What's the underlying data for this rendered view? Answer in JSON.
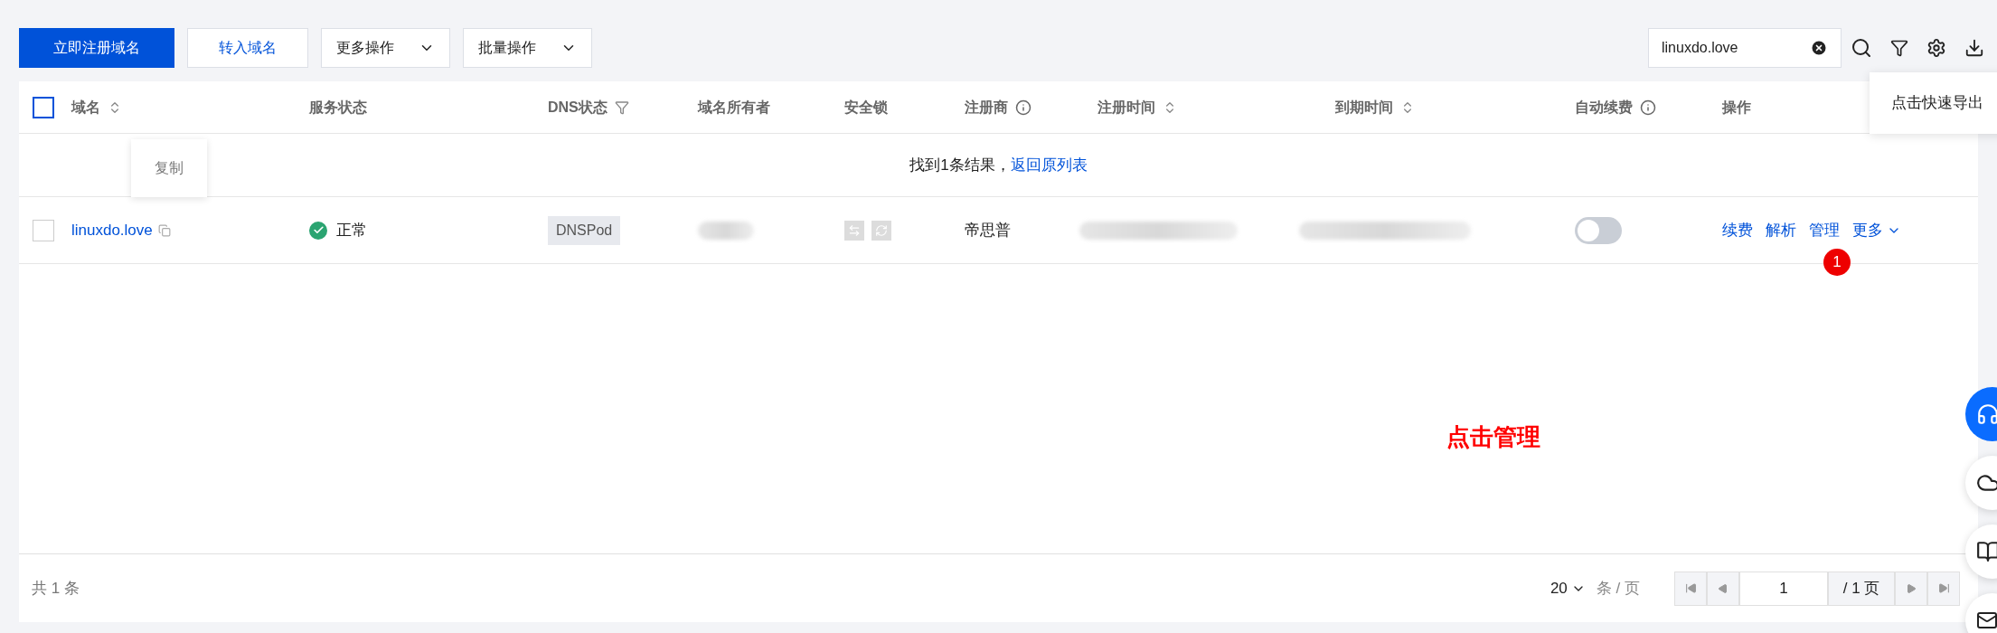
{
  "toolbar": {
    "buttons": [
      {
        "label": "立即注册域名",
        "kind": "primary"
      },
      {
        "label": "转入域名",
        "kind": "link"
      },
      {
        "label": "更多操作",
        "kind": "dropdown"
      },
      {
        "label": "批量操作",
        "kind": "dropdown"
      }
    ],
    "search": {
      "value": "linuxdo.love"
    },
    "export_tooltip": "点击快速导出"
  },
  "table": {
    "select_all": {
      "checked": false
    },
    "columns": [
      {
        "label": "域名",
        "kind": "sort"
      },
      {
        "label": "服务状态",
        "kind": "plain"
      },
      {
        "label": "DNS状态",
        "kind": "filter"
      },
      {
        "label": "域名所有者",
        "kind": "plain"
      },
      {
        "label": "安全锁",
        "kind": "plain"
      },
      {
        "label": "注册商",
        "kind": "info"
      },
      {
        "label": "注册时间",
        "kind": "sort"
      },
      {
        "label": "到期时间",
        "kind": "sort"
      },
      {
        "label": "自动续费",
        "kind": "info"
      },
      {
        "label": "操作",
        "kind": "plain"
      }
    ],
    "result_notice": {
      "text": "找到1条结果，",
      "link": "返回原列表"
    },
    "rows": [
      {
        "checked": false,
        "domain": "linuxdo.love",
        "copy_tooltip": "复制",
        "status": "正常",
        "dns": "DNSPod",
        "registrar": "帝思普",
        "auto_renew": {
          "on": false
        },
        "actions": [
          "续费",
          "解析",
          "管理",
          "更多"
        ],
        "badge": "1"
      }
    ]
  },
  "annotation": "点击管理",
  "footer": {
    "total": "共 1 条",
    "page_size": "20",
    "page_size_unit": "条 / 页",
    "page": "1",
    "page_total": "/ 1 页"
  }
}
